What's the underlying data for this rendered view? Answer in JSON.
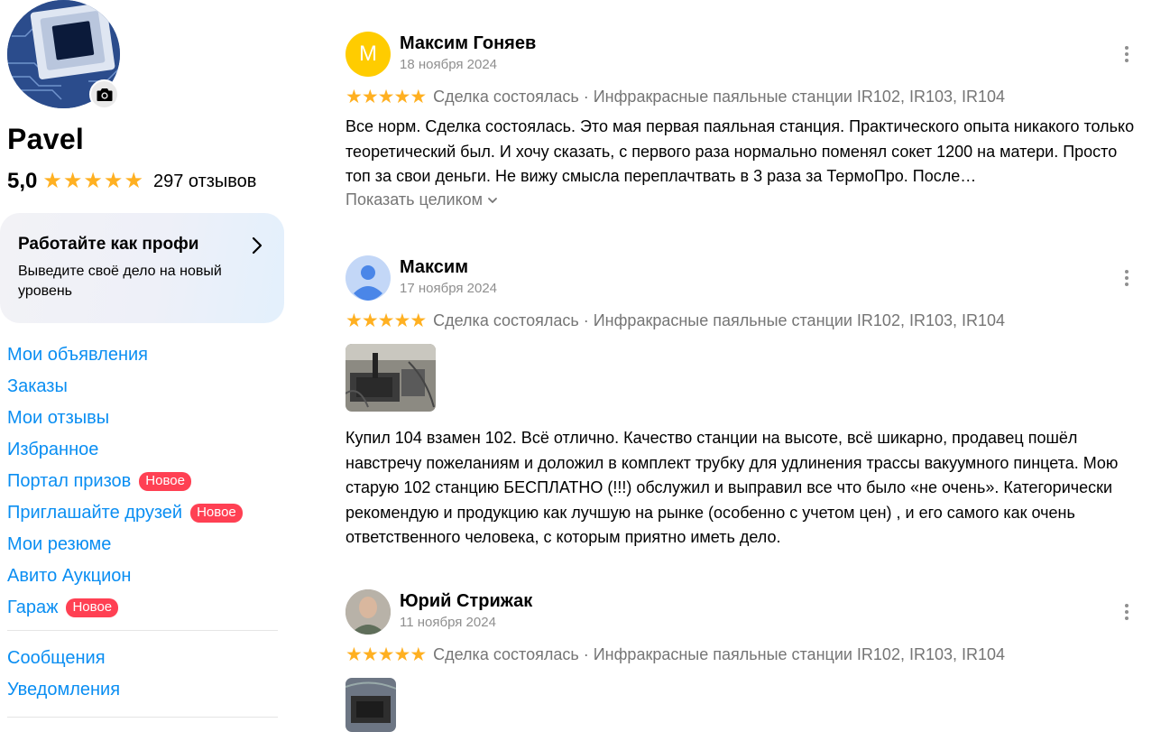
{
  "profile": {
    "name": "Pavel",
    "rating": "5,0",
    "stars": 5,
    "reviews_count": "297 отзывов"
  },
  "pro_card": {
    "title": "Работайте как профи",
    "subtitle": "Выведите своё дело на новый уровень"
  },
  "nav": {
    "items": [
      {
        "label": "Мои объявления"
      },
      {
        "label": "Заказы"
      },
      {
        "label": "Мои отзывы"
      },
      {
        "label": "Избранное"
      },
      {
        "label": "Портал призов",
        "badge": "Новое"
      },
      {
        "label": "Приглашайте друзей",
        "badge": "Новое"
      },
      {
        "label": "Мои резюме"
      },
      {
        "label": "Авито Аукцион"
      },
      {
        "label": "Гараж",
        "badge": "Новое"
      }
    ],
    "secondary": [
      {
        "label": "Сообщения"
      },
      {
        "label": "Уведомления"
      }
    ]
  },
  "reviews": [
    {
      "avatar_letter": "М",
      "author": "Максим Гоняев",
      "date": "18 ноября 2024",
      "stars": 5,
      "deal": "Сделка состоялась · Инфракрасные паяльные станции IR102, IR103, IR104",
      "text": "Все норм. Сделка состоялась. Это мая первая паяльная станция. Практического опыта никакого только теоретический был. И хочу сказать, с первого раза нормально поменял сокет 1200 на матери. Просто топ за свои деньги. Не вижу смысла переплачтвать в 3 раза за ТермоПро. После…",
      "show_more": "Показать целиком"
    },
    {
      "author": "Максим",
      "date": "17 ноября 2024",
      "stars": 5,
      "deal": "Сделка состоялась · Инфракрасные паяльные станции IR102, IR103, IR104",
      "text": "Купил 104 взамен 102. Всё отлично. Качество станции на высоте, всё шикарно, продавец пошёл навстречу пожеланиям и доложил в комплект трубку для удлинения трассы вакуумного пинцета. Мою старую 102 станцию БЕСПЛАТНО (!!!) обслужил и выправил все что было «не очень». Категорически рекомендую и продукцию как лучшую на рынке (особенно с учетом цен) , и его самого как очень ответственного человека, с которым приятно иметь дело."
    },
    {
      "author": "Юрий Стрижак",
      "date": "11 ноября 2024",
      "stars": 5,
      "deal": "Сделка состоялась · Инфракрасные паяльные станции IR102, IR103, IR104"
    }
  ],
  "icons": {
    "camera": "camera-icon",
    "chevron_right": "chevron-right-icon",
    "chevron_down": "chevron-down-icon",
    "more": "more-vertical-icon",
    "star": "star-icon"
  },
  "colors": {
    "link": "#0a8ef2",
    "star": "#ffb021",
    "badge": "#ff4053",
    "muted": "#757575",
    "letter_avatar": "#ffcc00"
  }
}
